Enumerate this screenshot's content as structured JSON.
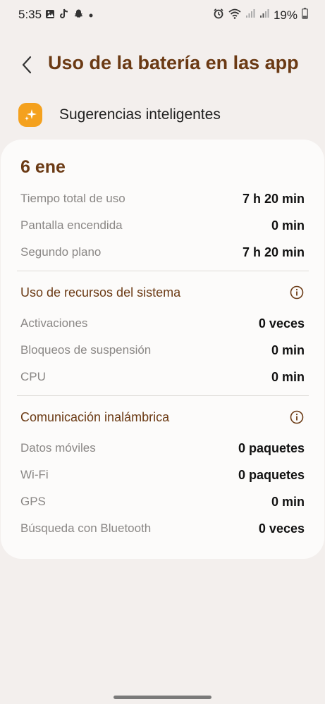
{
  "status_bar": {
    "time": "5:35",
    "battery": "19%"
  },
  "header": {
    "title": "Uso de la batería en las app"
  },
  "suggestions": {
    "label": "Sugerencias inteligentes"
  },
  "card": {
    "date": "6 ene",
    "usage": [
      {
        "label": "Tiempo total de uso",
        "value": "7 h 20 min"
      },
      {
        "label": "Pantalla encendida",
        "value": "0 min"
      },
      {
        "label": "Segundo plano",
        "value": "7 h 20 min"
      }
    ],
    "system_resources": {
      "title": "Uso de recursos del sistema",
      "items": [
        {
          "label": "Activaciones",
          "value": "0 veces"
        },
        {
          "label": "Bloqueos de suspensión",
          "value": "0 min"
        },
        {
          "label": "CPU",
          "value": "0 min"
        }
      ]
    },
    "wireless": {
      "title": "Comunicación inalámbrica",
      "items": [
        {
          "label": "Datos móviles",
          "value": "0 paquetes"
        },
        {
          "label": "Wi-Fi",
          "value": "0 paquetes"
        },
        {
          "label": "GPS",
          "value": "0 min"
        },
        {
          "label": "Búsqueda con Bluetooth",
          "value": "0 veces"
        }
      ]
    }
  },
  "colors": {
    "accent": "#6b3a14",
    "suggest_icon_bg": "#f4a11e",
    "background": "#f3efed",
    "card": "#fcfbfa"
  }
}
